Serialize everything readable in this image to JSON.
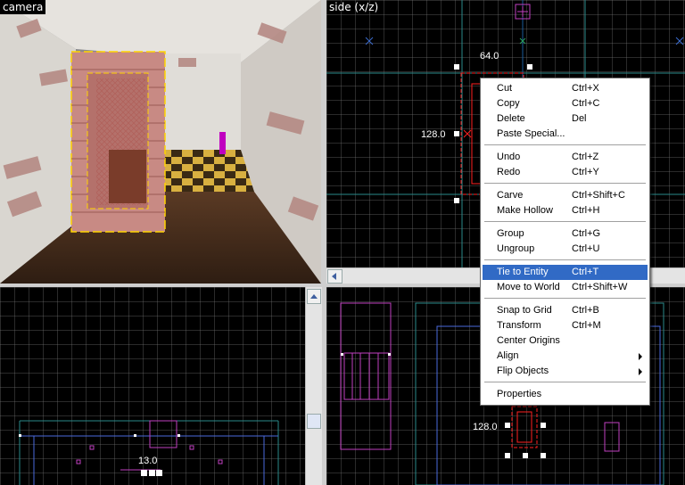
{
  "viewports": {
    "camera": {
      "title": "camera"
    },
    "side": {
      "title": "side (x/z)",
      "width_label": "64.0",
      "height_label": "128.0"
    },
    "top_left": {
      "width_label": "13.0"
    },
    "bottom_right": {
      "height_label": "128.0"
    }
  },
  "context_menu": {
    "items": [
      {
        "label": "Cut",
        "shortcut": "Ctrl+X"
      },
      {
        "label": "Copy",
        "shortcut": "Ctrl+C"
      },
      {
        "label": "Delete",
        "shortcut": "Del"
      },
      {
        "label": "Paste Special...",
        "shortcut": ""
      },
      {
        "label": "Undo",
        "shortcut": "Ctrl+Z"
      },
      {
        "label": "Redo",
        "shortcut": "Ctrl+Y"
      },
      {
        "label": "Carve",
        "shortcut": "Ctrl+Shift+C"
      },
      {
        "label": "Make Hollow",
        "shortcut": "Ctrl+H"
      },
      {
        "label": "Group",
        "shortcut": "Ctrl+G"
      },
      {
        "label": "Ungroup",
        "shortcut": "Ctrl+U"
      },
      {
        "label": "Tie to Entity",
        "shortcut": "Ctrl+T",
        "selected": true
      },
      {
        "label": "Move to World",
        "shortcut": "Ctrl+Shift+W"
      },
      {
        "label": "Snap to Grid",
        "shortcut": "Ctrl+B"
      },
      {
        "label": "Transform",
        "shortcut": "Ctrl+M"
      },
      {
        "label": "Center Origins",
        "shortcut": ""
      },
      {
        "label": "Align",
        "shortcut": "",
        "submenu": true
      },
      {
        "label": "Flip Objects",
        "shortcut": "",
        "submenu": true
      },
      {
        "label": "Properties",
        "shortcut": ""
      }
    ]
  },
  "colors": {
    "selection": "#ff2020",
    "brush": "#c040c0",
    "menu_highlight": "#316ac5",
    "grid_major": "#2a8a8a"
  }
}
